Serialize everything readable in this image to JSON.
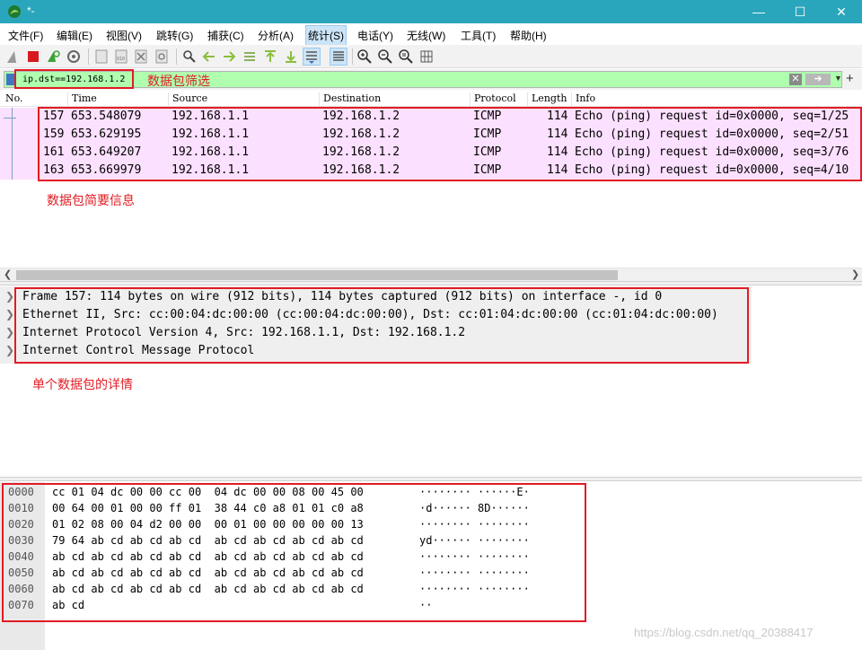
{
  "window": {
    "title": "*-"
  },
  "menu": {
    "items": [
      "文件(F)",
      "编辑(E)",
      "视图(V)",
      "跳转(G)",
      "捕获(C)",
      "分析(A)",
      "统计(S)",
      "电话(Y)",
      "无线(W)",
      "工具(T)",
      "帮助(H)"
    ]
  },
  "toolbar": {
    "icons": [
      "shark-fin-icon",
      "stop-capture-icon",
      "restart-capture-icon",
      "capture-options-icon",
      "open-file-icon",
      "save-file-icon",
      "close-file-icon",
      "reload-file-icon",
      "find-packet-icon",
      "go-back-icon",
      "go-forward-icon",
      "go-to-packet-icon",
      "first-packet-icon",
      "last-packet-icon",
      "autoscroll-icon",
      "colorize-icon",
      "zoom-in-icon",
      "zoom-out-icon",
      "normal-size-icon",
      "resize-columns-icon"
    ]
  },
  "filter": {
    "value": "ip.dst==192.168.1.2"
  },
  "packet_list": {
    "columns": [
      "No.",
      "Time",
      "Source",
      "Destination",
      "Protocol",
      "Length",
      "Info"
    ],
    "rows": [
      {
        "no": "157",
        "time": "653.548079",
        "source": "192.168.1.1",
        "destination": "192.168.1.2",
        "protocol": "ICMP",
        "length": "114",
        "info": "Echo (ping) request  id=0x0000, seq=1/25"
      },
      {
        "no": "159",
        "time": "653.629195",
        "source": "192.168.1.1",
        "destination": "192.168.1.2",
        "protocol": "ICMP",
        "length": "114",
        "info": "Echo (ping) request  id=0x0000, seq=2/51"
      },
      {
        "no": "161",
        "time": "653.649207",
        "source": "192.168.1.1",
        "destination": "192.168.1.2",
        "protocol": "ICMP",
        "length": "114",
        "info": "Echo (ping) request  id=0x0000, seq=3/76"
      },
      {
        "no": "163",
        "time": "653.669979",
        "source": "192.168.1.1",
        "destination": "192.168.1.2",
        "protocol": "ICMP",
        "length": "114",
        "info": "Echo (ping) request  id=0x0000, seq=4/10"
      }
    ]
  },
  "details": {
    "lines": [
      "Frame 157: 114 bytes on wire (912 bits), 114 bytes captured (912 bits) on interface -, id 0",
      "Ethernet II, Src: cc:00:04:dc:00:00 (cc:00:04:dc:00:00), Dst: cc:01:04:dc:00:00 (cc:01:04:dc:00:00)",
      "Internet Protocol Version 4, Src: 192.168.1.1, Dst: 192.168.1.2",
      "Internet Control Message Protocol"
    ]
  },
  "hex": {
    "lines": [
      {
        "offset": "0000",
        "bytes": "cc 01 04 dc 00 00 cc 00  04 dc 00 00 08 00 45 00",
        "ascii": "········ ······E·"
      },
      {
        "offset": "0010",
        "bytes": "00 64 00 01 00 00 ff 01  38 44 c0 a8 01 01 c0 a8",
        "ascii": "·d······ 8D······"
      },
      {
        "offset": "0020",
        "bytes": "01 02 08 00 04 d2 00 00  00 01 00 00 00 00 00 13",
        "ascii": "········ ········"
      },
      {
        "offset": "0030",
        "bytes": "79 64 ab cd ab cd ab cd  ab cd ab cd ab cd ab cd",
        "ascii": "yd······ ········"
      },
      {
        "offset": "0040",
        "bytes": "ab cd ab cd ab cd ab cd  ab cd ab cd ab cd ab cd",
        "ascii": "········ ········"
      },
      {
        "offset": "0050",
        "bytes": "ab cd ab cd ab cd ab cd  ab cd ab cd ab cd ab cd",
        "ascii": "········ ········"
      },
      {
        "offset": "0060",
        "bytes": "ab cd ab cd ab cd ab cd  ab cd ab cd ab cd ab cd",
        "ascii": "········ ········"
      },
      {
        "offset": "0070",
        "bytes": "ab cd",
        "ascii": "··"
      }
    ]
  },
  "annotations": {
    "filter_label": "数据包筛选",
    "list_label": "数据包简要信息",
    "detail_label": "单个数据包的详情"
  },
  "watermark": "https://blog.csdn.net/qq_20388417",
  "colors": {
    "titlebar": "#2aa6bc",
    "filter_ok": "#afffaf",
    "packet_row": "#fce0ff",
    "annotation": "#e21c24"
  }
}
